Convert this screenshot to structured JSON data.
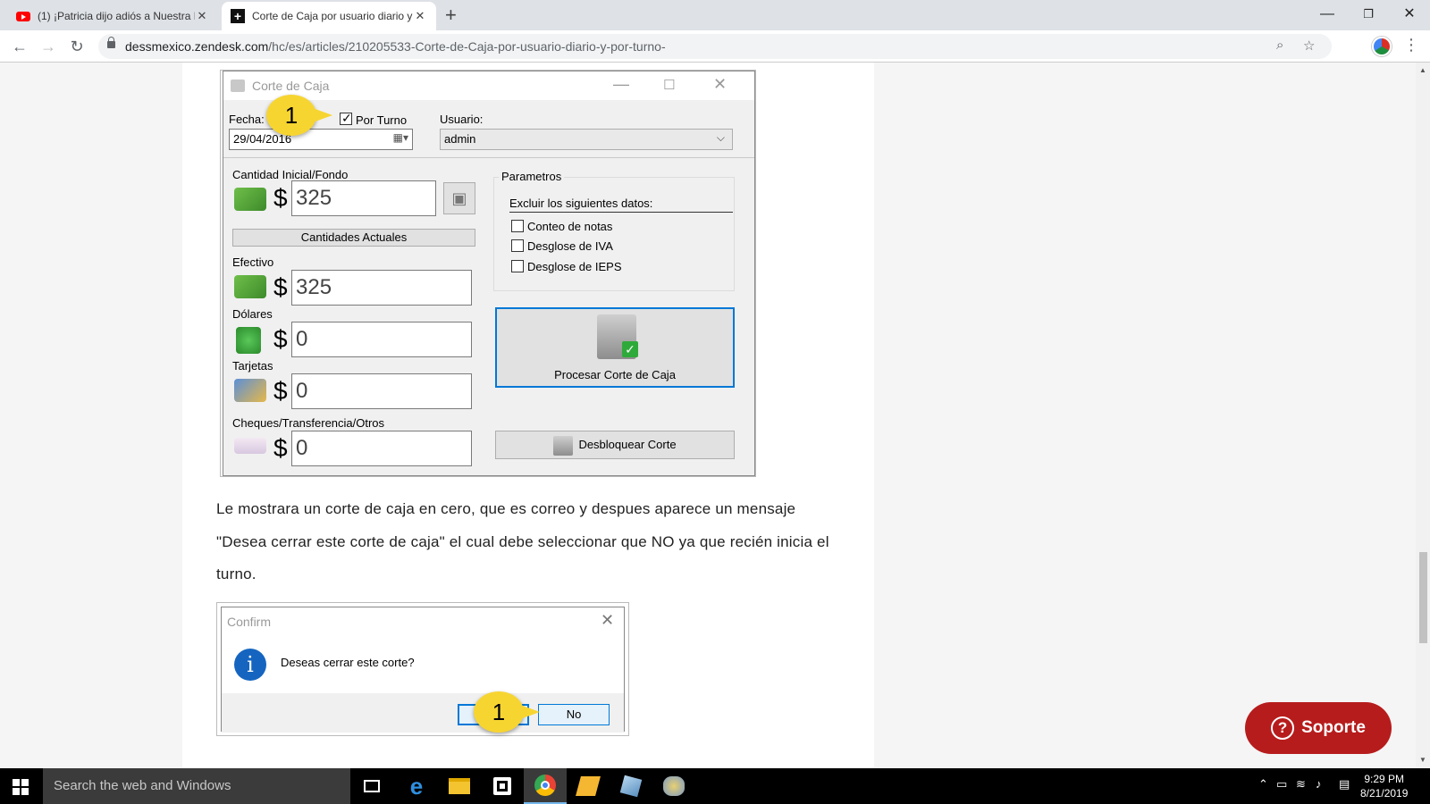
{
  "browser": {
    "tabs": [
      {
        "title": "(1) ¡Patricia dijo adiós a Nuestra B",
        "icon": "youtube-icon"
      },
      {
        "title": "Corte de Caja por usuario diario y",
        "icon": "zendesk-icon"
      }
    ],
    "url_host": "dessmexico.zendesk.com",
    "url_path": "/hc/es/articles/210205533-Corte-de-Caja-por-usuario-diario-y-por-turno-"
  },
  "corte_dialog": {
    "title": "Corte de Caja",
    "fecha_label": "Fecha:",
    "fecha_value": "29/04/2016",
    "por_turno_label": "Por Turno",
    "por_turno_checked": true,
    "usuario_label": "Usuario:",
    "usuario_value": "admin",
    "cantidad_inicial_label": "Cantidad Inicial/Fondo",
    "cantidad_inicial_value": "325",
    "cantidades_actuales_button": "Cantidades Actuales",
    "efectivo_label": "Efectivo",
    "efectivo_value": "325",
    "dolares_label": "Dólares",
    "dolares_value": "0",
    "tarjetas_label": "Tarjetas",
    "tarjetas_value": "0",
    "cheques_label": "Cheques/Transferencia/Otros",
    "cheques_value": "0",
    "currency_symbol": "$",
    "parametros_label": "Parametros",
    "excluir_label": "Excluir los siguientes datos:",
    "options": [
      "Conteo de notas",
      "Desglose de IVA",
      "Desglose de IEPS"
    ],
    "procesar_button": "Procesar Corte de Caja",
    "desbloquear_button": "Desbloquear Corte",
    "callout_number": "1"
  },
  "paragraph": {
    "text": "Le mostrara un corte de caja en cero, que es correo y despues aparece un mensaje \"Desea cerrar este corte de caja\" el cual debe seleccionar que NO ya que recién inicia el turno."
  },
  "confirm_dialog": {
    "title": "Confirm",
    "message": "Deseas cerrar este corte?",
    "no_button": "No",
    "info_glyph": "i",
    "callout_number": "1"
  },
  "soporte_button": {
    "label": "Soporte",
    "glyph": "?"
  },
  "taskbar": {
    "search_placeholder": "Search the web and Windows",
    "time": "9:29 PM",
    "date": "8/21/2019"
  }
}
